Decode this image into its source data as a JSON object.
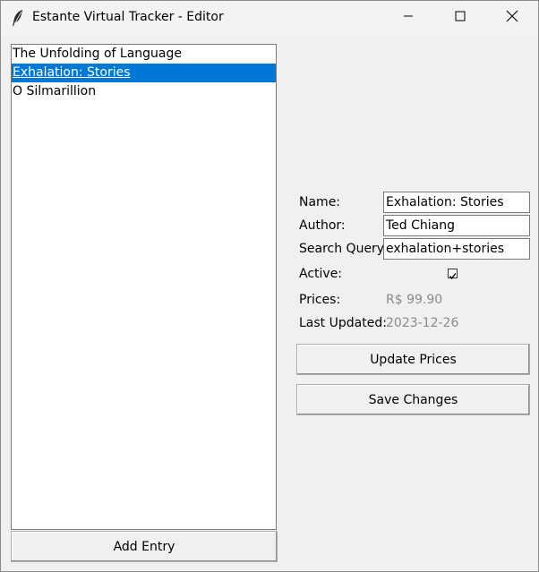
{
  "window": {
    "title": "Estante Virtual Tracker - Editor",
    "icon": "feather-icon"
  },
  "list": {
    "items": [
      {
        "label": "The Unfolding of Language",
        "selected": false
      },
      {
        "label": "Exhalation: Stories",
        "selected": true
      },
      {
        "label": "O Silmarillion",
        "selected": false
      }
    ],
    "selection_color": "#0078d7"
  },
  "buttons": {
    "add_entry": "Add Entry",
    "update_prices": "Update Prices",
    "save_changes": "Save Changes"
  },
  "form": {
    "name_label": "Name:",
    "name_value": "Exhalation: Stories",
    "author_label": "Author:",
    "author_value": "Ted Chiang",
    "query_label": "Search Query:",
    "query_value": "exhalation+stories",
    "active_label": "Active:",
    "active_checked": true,
    "prices_label": "Prices:",
    "prices_value": "R$ 99.90",
    "updated_label": "Last Updated:",
    "updated_value": "2023-12-26"
  }
}
